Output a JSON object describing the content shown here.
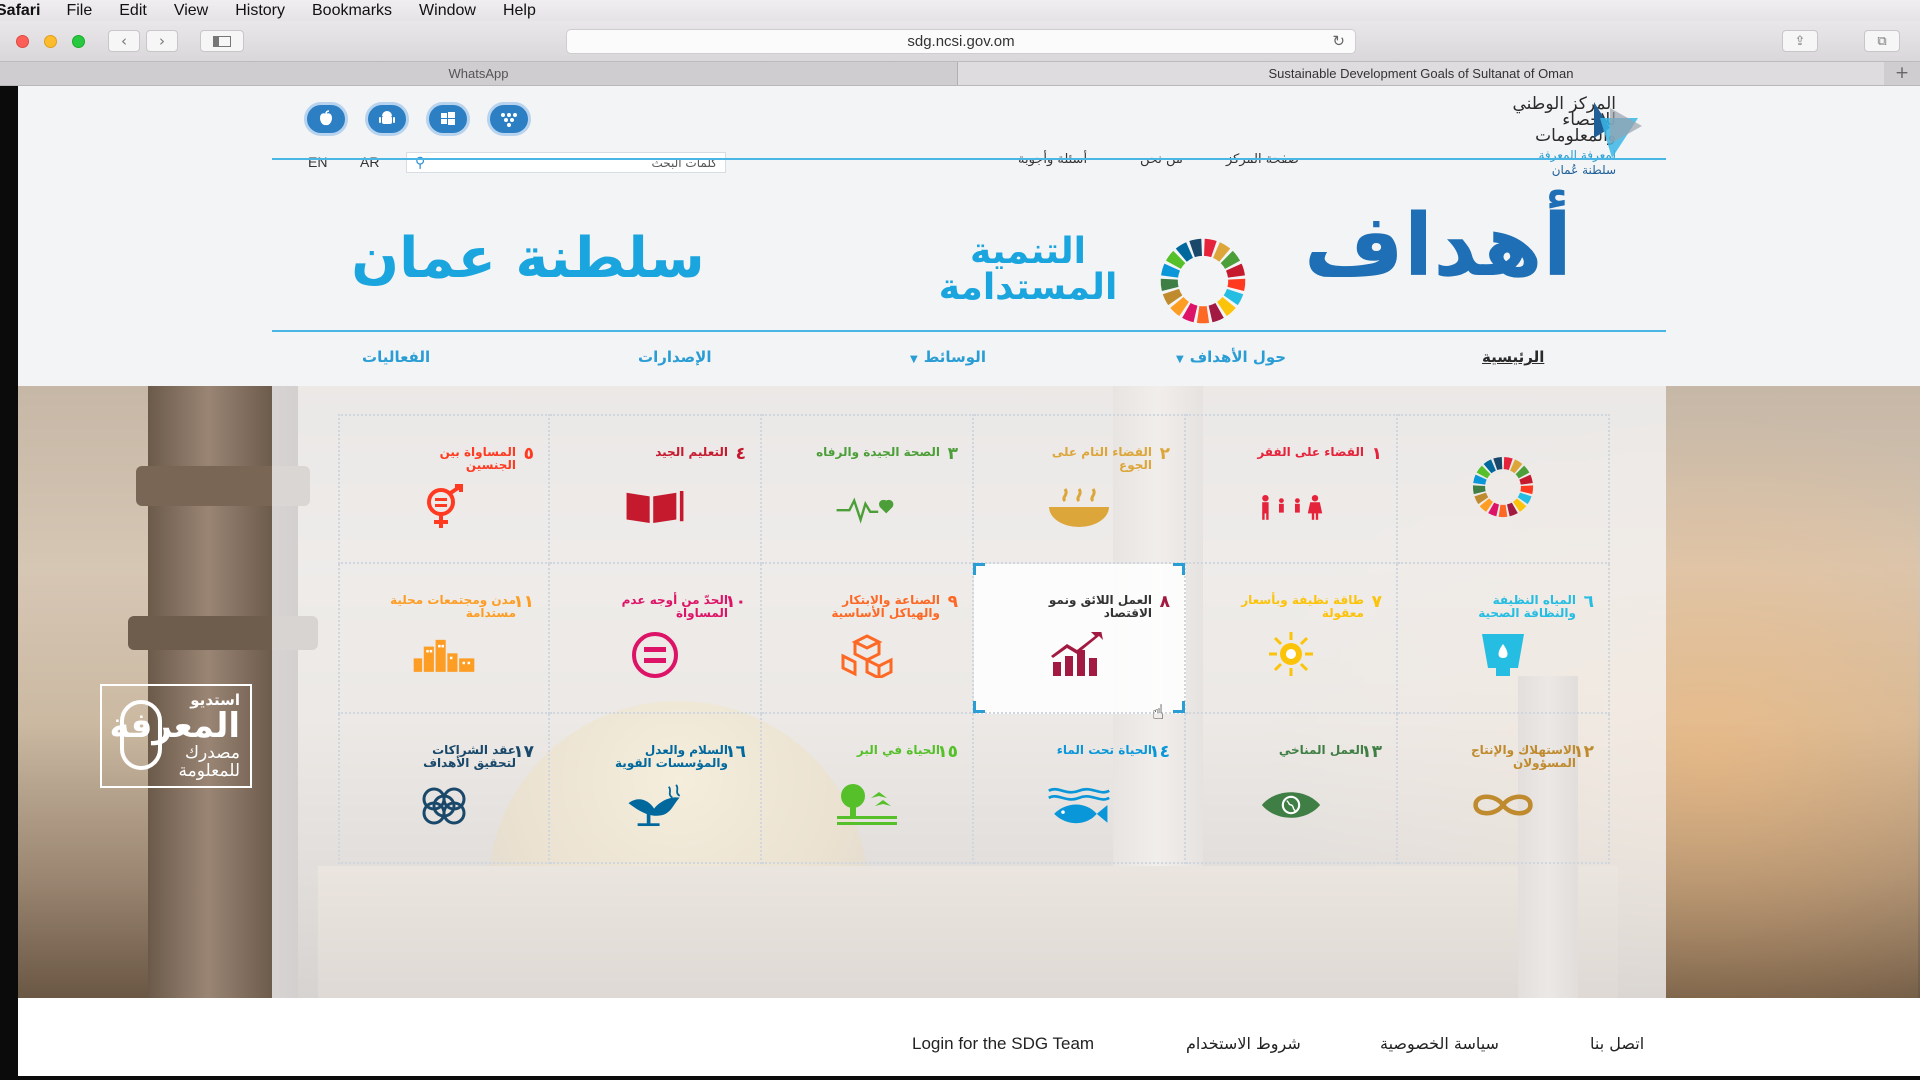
{
  "menubar": {
    "app": "Safari",
    "items": [
      "File",
      "Edit",
      "View",
      "History",
      "Bookmarks",
      "Window",
      "Help"
    ]
  },
  "browser": {
    "url": "sdg.ncsi.gov.om",
    "tabs": [
      "WhatsApp",
      "Sustainable Development Goals of Sultanat of Oman"
    ]
  },
  "header": {
    "lang_en": "EN",
    "lang_ar": "AR",
    "search_placeholder": "كلمات البحث",
    "links": [
      "صفحة المركز",
      "من نحن",
      "أسئلة وأجوبة"
    ],
    "logo_line1": "المركز الوطني",
    "logo_line2": "للإحصاء",
    "logo_line3": "والمعلومات",
    "logo_sub1": "لمعرفة المعرفة",
    "logo_sub2": "سلطنة عُمان"
  },
  "banner": {
    "oman": "سلطنة عمان",
    "ahdaf": "أهداف",
    "tanmia1": "التنمية",
    "tanmia2": "المستدامة"
  },
  "nav": {
    "home": "الرئيسية",
    "about": "حول الأهداف",
    "media": "الوسائط",
    "publications": "الإصدارات",
    "events": "الفعاليات"
  },
  "goals": [
    {
      "num": "",
      "title": "",
      "color": "#ffffff"
    },
    {
      "num": "١",
      "title": "القضاء على الفقر",
      "color": "#e5243b"
    },
    {
      "num": "٢",
      "title": "القضاء التام على الجوع",
      "color": "#dda63a"
    },
    {
      "num": "٣",
      "title": "الصحة الجيدة والرفاه",
      "color": "#4c9f38"
    },
    {
      "num": "٤",
      "title": "التعليم الجيد",
      "color": "#c5192d"
    },
    {
      "num": "٥",
      "title": "المساواة بين الجنسين",
      "color": "#ff3a21"
    },
    {
      "num": "٦",
      "title": "المياه النظيفة والنظافة الصحية",
      "color": "#26bde2"
    },
    {
      "num": "٧",
      "title": "طاقة نظيفة وبأسعار معقولة",
      "color": "#fcc30b"
    },
    {
      "num": "٨",
      "title": "العمل اللائق ونمو الاقتصاد",
      "color": "#a21942"
    },
    {
      "num": "٩",
      "title": "الصناعة والابتكار والهياكل الأساسية",
      "color": "#fd6925"
    },
    {
      "num": "١٠",
      "title": "الحدّ من أوجه عدم المساواة",
      "color": "#dd1367"
    },
    {
      "num": "١١",
      "title": "مدن ومجتمعات محلية مستدامة",
      "color": "#fd9d24"
    },
    {
      "num": "١٢",
      "title": "الاستهلاك والإنتاج المسؤولان",
      "color": "#bf8b2e"
    },
    {
      "num": "١٣",
      "title": "العمل المناخي",
      "color": "#3f7e44"
    },
    {
      "num": "١٤",
      "title": "الحياة تحت الماء",
      "color": "#0a97d9"
    },
    {
      "num": "١٥",
      "title": "الحياة في البر",
      "color": "#56c02b"
    },
    {
      "num": "١٦",
      "title": "السلام والعدل والمؤسسات القوية",
      "color": "#00689d"
    },
    {
      "num": "١٧",
      "title": "عقد الشراكات لتحقيق الأهداف",
      "color": "#19486a"
    }
  ],
  "studio": {
    "line1": "استديو",
    "line2": "المعرفة",
    "line3": "مصدرك",
    "line4": "للمعلومة"
  },
  "footer": {
    "contact": "اتصل بنا",
    "privacy": "سياسة الخصوصية",
    "terms": "شروط الاستخدام",
    "login": "Login for the SDG Team"
  }
}
